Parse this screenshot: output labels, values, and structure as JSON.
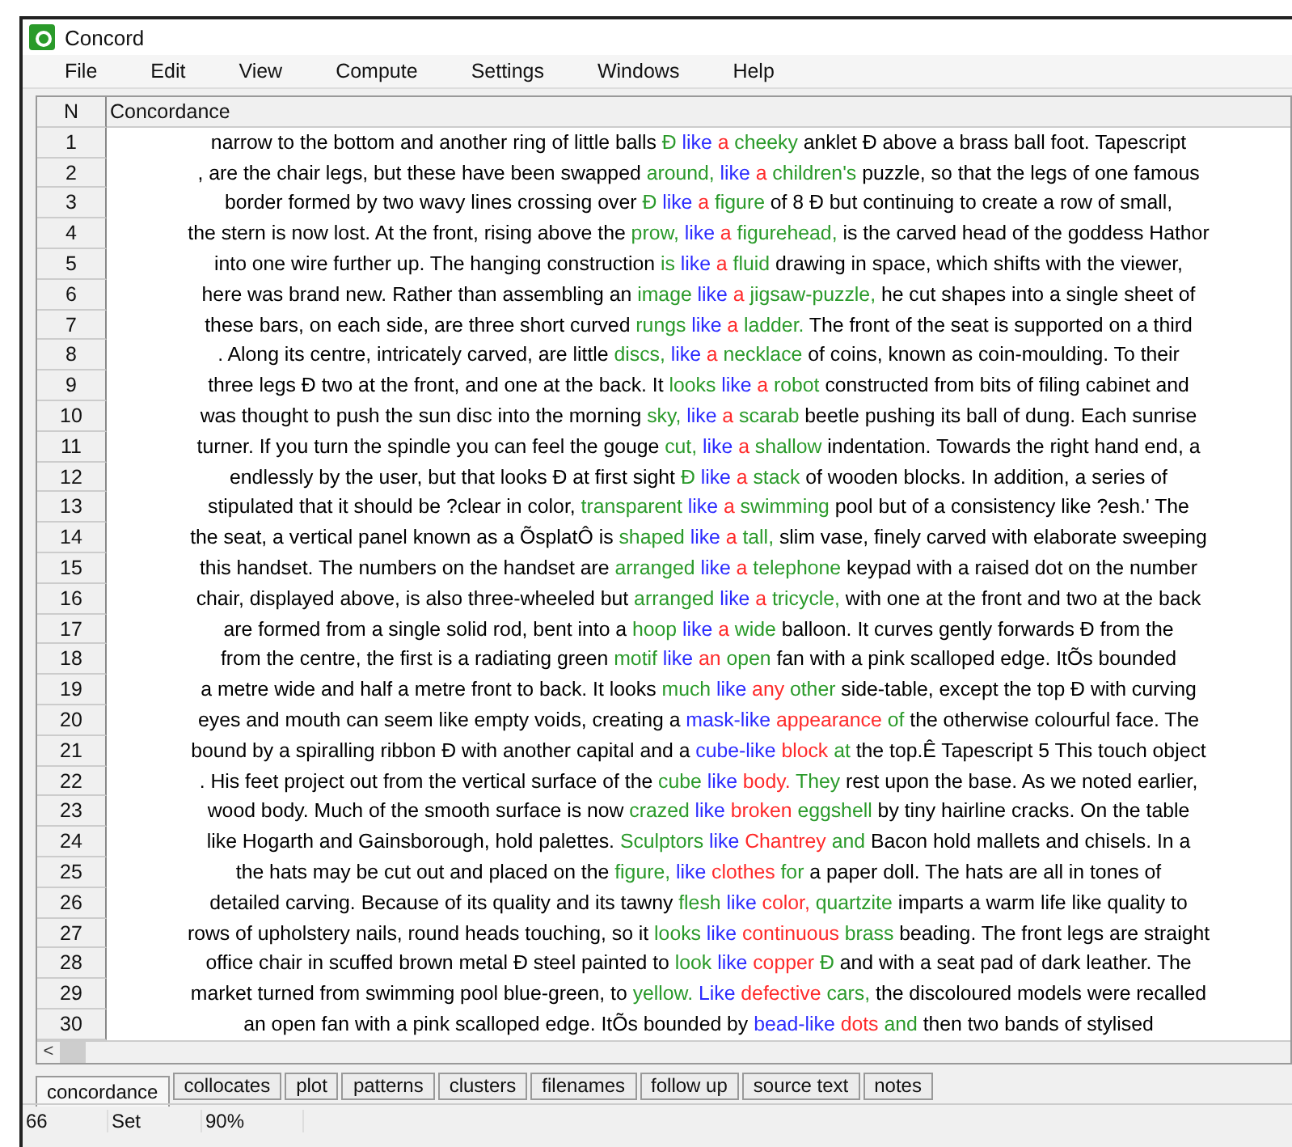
{
  "window": {
    "title": "Concord"
  },
  "menu": [
    "File",
    "Edit",
    "View",
    "Compute",
    "Settings",
    "Windows",
    "Help"
  ],
  "table": {
    "columns": [
      "N",
      "Concordance"
    ],
    "rows": [
      {
        "n": "1",
        "segments": [
          {
            "text": "narrow to the bottom and another ring of little balls ",
            "color": "#000000"
          },
          {
            "text": "Ð",
            "color": "#2a9a2a"
          },
          {
            "text": " like",
            "color": "#2b2bff"
          },
          {
            "text": " a",
            "color": "#ff2a2a"
          },
          {
            "text": " cheeky",
            "color": "#2a9a2a"
          },
          {
            "text": " anklet Ð above a brass ball foot. Tapescript",
            "color": "#000000"
          }
        ]
      },
      {
        "n": "2",
        "segments": [
          {
            "text": ", are the chair legs, but these have been swapped ",
            "color": "#000000"
          },
          {
            "text": "around,",
            "color": "#2a9a2a"
          },
          {
            "text": " like",
            "color": "#2b2bff"
          },
          {
            "text": " a",
            "color": "#ff2a2a"
          },
          {
            "text": " children's",
            "color": "#2a9a2a"
          },
          {
            "text": " puzzle, so that the legs of one famous",
            "color": "#000000"
          }
        ]
      },
      {
        "n": "3",
        "segments": [
          {
            "text": "border formed by two wavy lines crossing over ",
            "color": "#000000"
          },
          {
            "text": "Ð",
            "color": "#2a9a2a"
          },
          {
            "text": " like",
            "color": "#2b2bff"
          },
          {
            "text": " a",
            "color": "#ff2a2a"
          },
          {
            "text": " figure",
            "color": "#2a9a2a"
          },
          {
            "text": " of 8 Ð but continuing to create a row of small,",
            "color": "#000000"
          }
        ]
      },
      {
        "n": "4",
        "segments": [
          {
            "text": "the stern is now lost. At the front, rising above the ",
            "color": "#000000"
          },
          {
            "text": "prow,",
            "color": "#2a9a2a"
          },
          {
            "text": " like",
            "color": "#2b2bff"
          },
          {
            "text": " a",
            "color": "#ff2a2a"
          },
          {
            "text": " figurehead,",
            "color": "#2a9a2a"
          },
          {
            "text": " is the carved head of the goddess Hathor",
            "color": "#000000"
          }
        ]
      },
      {
        "n": "5",
        "segments": [
          {
            "text": "into one wire further up. The hanging construction ",
            "color": "#000000"
          },
          {
            "text": "is",
            "color": "#2a9a2a"
          },
          {
            "text": " like",
            "color": "#2b2bff"
          },
          {
            "text": " a",
            "color": "#ff2a2a"
          },
          {
            "text": " fluid",
            "color": "#2a9a2a"
          },
          {
            "text": " drawing in space, which shifts with the viewer,",
            "color": "#000000"
          }
        ]
      },
      {
        "n": "6",
        "segments": [
          {
            "text": "here was brand new. Rather than assembling an ",
            "color": "#000000"
          },
          {
            "text": "image",
            "color": "#2a9a2a"
          },
          {
            "text": " like",
            "color": "#2b2bff"
          },
          {
            "text": " a",
            "color": "#ff2a2a"
          },
          {
            "text": " jigsaw-puzzle,",
            "color": "#2a9a2a"
          },
          {
            "text": " he cut shapes into a single sheet of",
            "color": "#000000"
          }
        ]
      },
      {
        "n": "7",
        "segments": [
          {
            "text": "these bars, on each side, are three short curved ",
            "color": "#000000"
          },
          {
            "text": "rungs",
            "color": "#2a9a2a"
          },
          {
            "text": " like",
            "color": "#2b2bff"
          },
          {
            "text": " a",
            "color": "#ff2a2a"
          },
          {
            "text": " ladder.",
            "color": "#2a9a2a"
          },
          {
            "text": " The front of the seat is supported on a third",
            "color": "#000000"
          }
        ]
      },
      {
        "n": "8",
        "segments": [
          {
            "text": ". Along its centre, intricately carved, are little ",
            "color": "#000000"
          },
          {
            "text": "discs,",
            "color": "#2a9a2a"
          },
          {
            "text": " like",
            "color": "#2b2bff"
          },
          {
            "text": " a",
            "color": "#ff2a2a"
          },
          {
            "text": " necklace",
            "color": "#2a9a2a"
          },
          {
            "text": " of coins, known as coin-moulding. To their",
            "color": "#000000"
          }
        ]
      },
      {
        "n": "9",
        "segments": [
          {
            "text": "three legs Ð two at the front, and one at the back. It ",
            "color": "#000000"
          },
          {
            "text": "looks",
            "color": "#2a9a2a"
          },
          {
            "text": " like",
            "color": "#2b2bff"
          },
          {
            "text": " a",
            "color": "#ff2a2a"
          },
          {
            "text": " robot",
            "color": "#2a9a2a"
          },
          {
            "text": " constructed from bits of filing cabinet and",
            "color": "#000000"
          }
        ]
      },
      {
        "n": "10",
        "segments": [
          {
            "text": "was thought to push the sun disc into the morning ",
            "color": "#000000"
          },
          {
            "text": "sky,",
            "color": "#2a9a2a"
          },
          {
            "text": " like",
            "color": "#2b2bff"
          },
          {
            "text": " a",
            "color": "#ff2a2a"
          },
          {
            "text": " scarab",
            "color": "#2a9a2a"
          },
          {
            "text": " beetle pushing its ball of dung. Each sunrise",
            "color": "#000000"
          }
        ]
      },
      {
        "n": "11",
        "segments": [
          {
            "text": "turner. If you turn the spindle you can feel the gouge ",
            "color": "#000000"
          },
          {
            "text": "cut,",
            "color": "#2a9a2a"
          },
          {
            "text": " like",
            "color": "#2b2bff"
          },
          {
            "text": " a",
            "color": "#ff2a2a"
          },
          {
            "text": " shallow",
            "color": "#2a9a2a"
          },
          {
            "text": " indentation. Towards the right hand end, a",
            "color": "#000000"
          }
        ]
      },
      {
        "n": "12",
        "segments": [
          {
            "text": "endlessly by the user, but that looks Ð at first sight ",
            "color": "#000000"
          },
          {
            "text": "Ð",
            "color": "#2a9a2a"
          },
          {
            "text": " like",
            "color": "#2b2bff"
          },
          {
            "text": " a",
            "color": "#ff2a2a"
          },
          {
            "text": " stack",
            "color": "#2a9a2a"
          },
          {
            "text": " of wooden blocks. In addition, a series of",
            "color": "#000000"
          }
        ]
      },
      {
        "n": "13",
        "segments": [
          {
            "text": "stipulated that it should be ?clear in color, ",
            "color": "#000000"
          },
          {
            "text": "transparent",
            "color": "#2a9a2a"
          },
          {
            "text": " like",
            "color": "#2b2bff"
          },
          {
            "text": " a",
            "color": "#ff2a2a"
          },
          {
            "text": " swimming",
            "color": "#2a9a2a"
          },
          {
            "text": " pool but of a consistency like ?esh.' The",
            "color": "#000000"
          }
        ]
      },
      {
        "n": "14",
        "segments": [
          {
            "text": "the seat, a vertical panel known as a ÕsplatÔ is ",
            "color": "#000000"
          },
          {
            "text": "shaped",
            "color": "#2a9a2a"
          },
          {
            "text": " like",
            "color": "#2b2bff"
          },
          {
            "text": " a",
            "color": "#ff2a2a"
          },
          {
            "text": " tall,",
            "color": "#2a9a2a"
          },
          {
            "text": " slim vase, finely carved with elaborate sweeping",
            "color": "#000000"
          }
        ]
      },
      {
        "n": "15",
        "segments": [
          {
            "text": "this handset. The numbers on the handset are ",
            "color": "#000000"
          },
          {
            "text": "arranged",
            "color": "#2a9a2a"
          },
          {
            "text": " like",
            "color": "#2b2bff"
          },
          {
            "text": " a",
            "color": "#ff2a2a"
          },
          {
            "text": " telephone",
            "color": "#2a9a2a"
          },
          {
            "text": " keypad with a raised dot on the number",
            "color": "#000000"
          }
        ]
      },
      {
        "n": "16",
        "segments": [
          {
            "text": "chair, displayed above, is also three-wheeled but ",
            "color": "#000000"
          },
          {
            "text": "arranged",
            "color": "#2a9a2a"
          },
          {
            "text": " like",
            "color": "#2b2bff"
          },
          {
            "text": " a",
            "color": "#ff2a2a"
          },
          {
            "text": " tricycle,",
            "color": "#2a9a2a"
          },
          {
            "text": " with one at the front and two at the back",
            "color": "#000000"
          }
        ]
      },
      {
        "n": "17",
        "segments": [
          {
            "text": "are formed from a single solid rod, bent into a ",
            "color": "#000000"
          },
          {
            "text": "hoop",
            "color": "#2a9a2a"
          },
          {
            "text": " like",
            "color": "#2b2bff"
          },
          {
            "text": " a",
            "color": "#ff2a2a"
          },
          {
            "text": " wide",
            "color": "#2a9a2a"
          },
          {
            "text": " balloon. It curves gently forwards Ð from the",
            "color": "#000000"
          }
        ]
      },
      {
        "n": "18",
        "segments": [
          {
            "text": "from the centre, the first is a radiating green ",
            "color": "#000000"
          },
          {
            "text": "motif",
            "color": "#2a9a2a"
          },
          {
            "text": " like",
            "color": "#2b2bff"
          },
          {
            "text": " an",
            "color": "#ff2a2a"
          },
          {
            "text": " open",
            "color": "#2a9a2a"
          },
          {
            "text": " fan with a pink scalloped edge. ItÕs bounded",
            "color": "#000000"
          }
        ]
      },
      {
        "n": "19",
        "segments": [
          {
            "text": "a metre wide and half a metre front to back. It looks ",
            "color": "#000000"
          },
          {
            "text": "much",
            "color": "#2a9a2a"
          },
          {
            "text": " like",
            "color": "#2b2bff"
          },
          {
            "text": " any",
            "color": "#ff2a2a"
          },
          {
            "text": " other",
            "color": "#2a9a2a"
          },
          {
            "text": " side-table, except the top Ð with curving",
            "color": "#000000"
          }
        ]
      },
      {
        "n": "20",
        "segments": [
          {
            "text": "eyes and mouth can seem like empty voids, creating a ",
            "color": "#000000"
          },
          {
            "text": "mask-like",
            "color": "#2b2bff"
          },
          {
            "text": " appearance",
            "color": "#ff2a2a"
          },
          {
            "text": " of",
            "color": "#2a9a2a"
          },
          {
            "text": " the otherwise colourful face. The",
            "color": "#000000"
          }
        ]
      },
      {
        "n": "21",
        "segments": [
          {
            "text": "bound by a spiralling ribbon Ð with another capital and a ",
            "color": "#000000"
          },
          {
            "text": "cube-like",
            "color": "#2b2bff"
          },
          {
            "text": " block",
            "color": "#ff2a2a"
          },
          {
            "text": " at",
            "color": "#2a9a2a"
          },
          {
            "text": " the top.Ê Tapescript 5 This touch object",
            "color": "#000000"
          }
        ]
      },
      {
        "n": "22",
        "segments": [
          {
            "text": ". His feet project out from the vertical surface of the ",
            "color": "#000000"
          },
          {
            "text": "cube",
            "color": "#2a9a2a"
          },
          {
            "text": " like",
            "color": "#2b2bff"
          },
          {
            "text": " body.",
            "color": "#ff2a2a"
          },
          {
            "text": " They",
            "color": "#2a9a2a"
          },
          {
            "text": " rest upon the base. As we noted earlier,",
            "color": "#000000"
          }
        ]
      },
      {
        "n": "23",
        "segments": [
          {
            "text": "wood body. Much of the smooth surface is now ",
            "color": "#000000"
          },
          {
            "text": "crazed",
            "color": "#2a9a2a"
          },
          {
            "text": " like",
            "color": "#2b2bff"
          },
          {
            "text": " broken",
            "color": "#ff2a2a"
          },
          {
            "text": " eggshell",
            "color": "#2a9a2a"
          },
          {
            "text": " by tiny hairline cracks. On the table",
            "color": "#000000"
          }
        ]
      },
      {
        "n": "24",
        "segments": [
          {
            "text": "like Hogarth and Gainsborough, hold palettes. ",
            "color": "#000000"
          },
          {
            "text": "Sculptors",
            "color": "#2a9a2a"
          },
          {
            "text": " like",
            "color": "#2b2bff"
          },
          {
            "text": " Chantrey",
            "color": "#ff2a2a"
          },
          {
            "text": " and",
            "color": "#2a9a2a"
          },
          {
            "text": " Bacon hold mallets and chisels. In a",
            "color": "#000000"
          }
        ]
      },
      {
        "n": "25",
        "segments": [
          {
            "text": "the hats may be cut out and placed on the ",
            "color": "#000000"
          },
          {
            "text": "figure,",
            "color": "#2a9a2a"
          },
          {
            "text": " like",
            "color": "#2b2bff"
          },
          {
            "text": " clothes",
            "color": "#ff2a2a"
          },
          {
            "text": " for",
            "color": "#2a9a2a"
          },
          {
            "text": " a paper doll. The hats are all in tones of",
            "color": "#000000"
          }
        ]
      },
      {
        "n": "26",
        "segments": [
          {
            "text": "detailed carving. Because of its quality and its tawny ",
            "color": "#000000"
          },
          {
            "text": "flesh",
            "color": "#2a9a2a"
          },
          {
            "text": " like",
            "color": "#2b2bff"
          },
          {
            "text": " color,",
            "color": "#ff2a2a"
          },
          {
            "text": " quartzite",
            "color": "#2a9a2a"
          },
          {
            "text": " imparts a warm life like quality to",
            "color": "#000000"
          }
        ]
      },
      {
        "n": "27",
        "segments": [
          {
            "text": "rows of upholstery nails, round heads touching, so it ",
            "color": "#000000"
          },
          {
            "text": "looks",
            "color": "#2a9a2a"
          },
          {
            "text": " like",
            "color": "#2b2bff"
          },
          {
            "text": " continuous",
            "color": "#ff2a2a"
          },
          {
            "text": " brass",
            "color": "#2a9a2a"
          },
          {
            "text": " beading. The front legs are straight",
            "color": "#000000"
          }
        ]
      },
      {
        "n": "28",
        "segments": [
          {
            "text": "office chair in scuffed brown metal Ð steel painted to ",
            "color": "#000000"
          },
          {
            "text": "look",
            "color": "#2a9a2a"
          },
          {
            "text": " like",
            "color": "#2b2bff"
          },
          {
            "text": " copper",
            "color": "#ff2a2a"
          },
          {
            "text": " Ð",
            "color": "#2a9a2a"
          },
          {
            "text": " and with a seat pad of dark leather. The",
            "color": "#000000"
          }
        ]
      },
      {
        "n": "29",
        "segments": [
          {
            "text": "market turned from swimming pool blue-green, to ",
            "color": "#000000"
          },
          {
            "text": "yellow.",
            "color": "#2a9a2a"
          },
          {
            "text": " Like",
            "color": "#2b2bff"
          },
          {
            "text": " defective",
            "color": "#ff2a2a"
          },
          {
            "text": " cars,",
            "color": "#2a9a2a"
          },
          {
            "text": " the discoloured models were recalled",
            "color": "#000000"
          }
        ]
      },
      {
        "n": "30",
        "segments": [
          {
            "text": "an open fan with a pink scalloped edge. ItÕs bounded by ",
            "color": "#000000"
          },
          {
            "text": "bead-like",
            "color": "#2b2bff"
          },
          {
            "text": " dots",
            "color": "#ff2a2a"
          },
          {
            "text": " and",
            "color": "#2a9a2a"
          },
          {
            "text": " then two bands of stylised",
            "color": "#000000"
          }
        ]
      }
    ]
  },
  "scrollbar": {
    "left_arrow": "<"
  },
  "tabs": [
    {
      "label": "concordance",
      "selected": true
    },
    {
      "label": "collocates",
      "selected": false
    },
    {
      "label": "plot",
      "selected": false
    },
    {
      "label": "patterns",
      "selected": false
    },
    {
      "label": "clusters",
      "selected": false
    },
    {
      "label": "filenames",
      "selected": false
    },
    {
      "label": "follow up",
      "selected": false
    },
    {
      "label": "source text",
      "selected": false
    },
    {
      "label": "notes",
      "selected": false
    }
  ],
  "status_bar": [
    "66",
    "Set",
    "90%"
  ]
}
